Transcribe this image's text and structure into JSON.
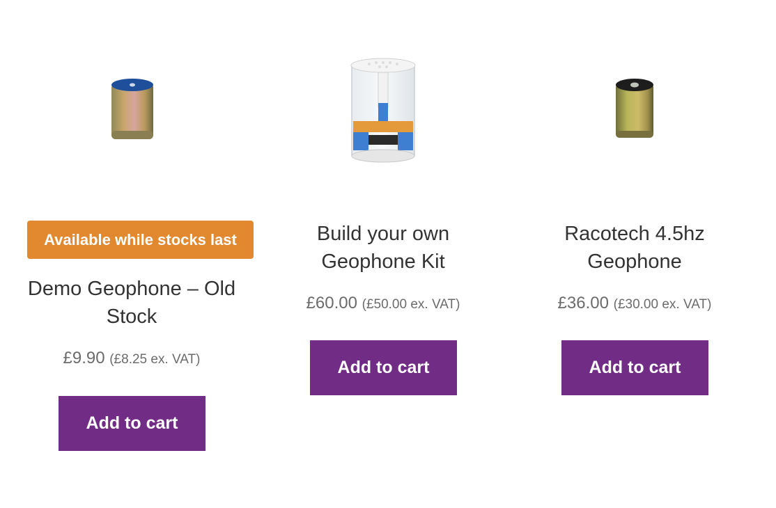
{
  "products": [
    {
      "badge": "Available while stocks last",
      "title_line1": "Demo Geophone – Old",
      "title_line2": "Stock",
      "price": "£9.90",
      "price_ex_vat": "(£8.25 ex. VAT)",
      "button_label": "Add to cart",
      "image_icon": "geophone-blue-top-image"
    },
    {
      "title_line1": "Build your own",
      "title_line2": "Geophone Kit",
      "price": "£60.00",
      "price_ex_vat": "(£50.00 ex. VAT)",
      "button_label": "Add to cart",
      "image_icon": "geophone-kit-image"
    },
    {
      "title_line1": "Racotech 4.5hz",
      "title_line2": "Geophone",
      "price": "£36.00",
      "price_ex_vat": "(£30.00 ex. VAT)",
      "button_label": "Add to cart",
      "image_icon": "geophone-black-top-image"
    }
  ],
  "colors": {
    "button": "#712c86",
    "badge": "#e2882f",
    "title": "#333333",
    "price": "#6b6b6b"
  }
}
